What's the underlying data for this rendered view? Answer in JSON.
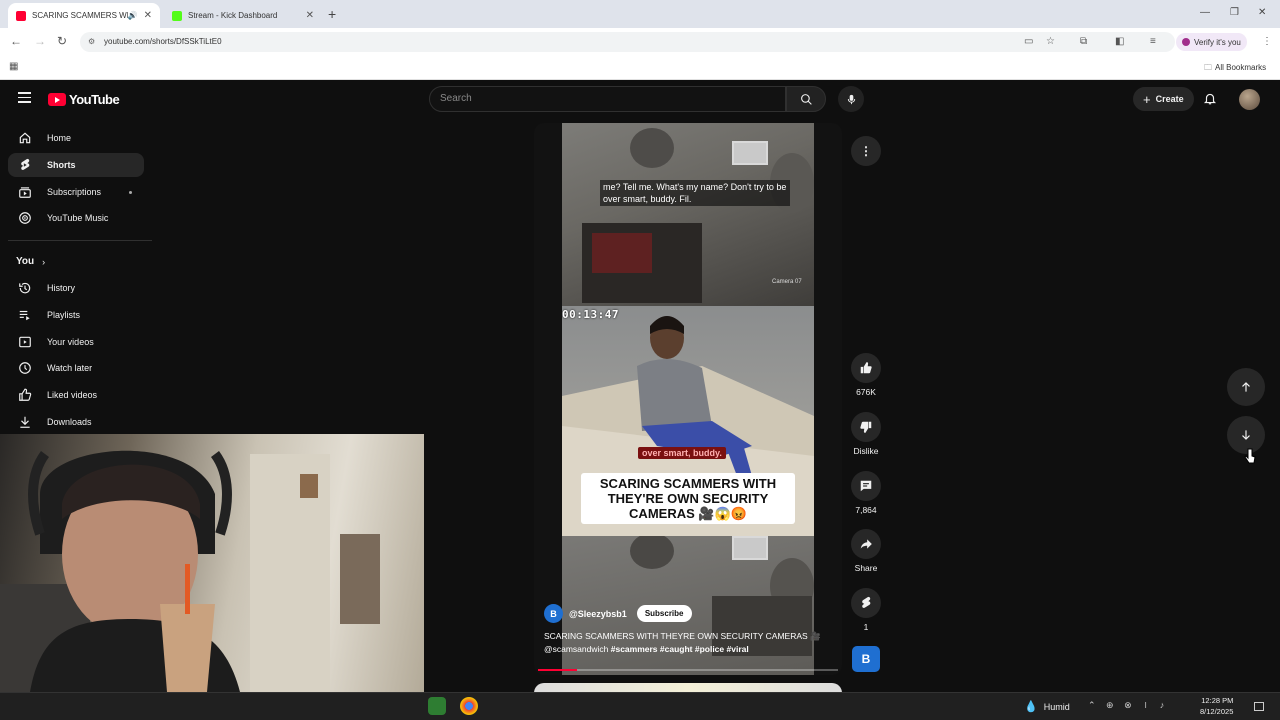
{
  "browser": {
    "tabs": [
      {
        "title": "SCARING SCAMMERS WITH",
        "active": true
      },
      {
        "title": "Stream - Kick Dashboard",
        "active": false
      }
    ],
    "url": "youtube.com/shorts/DfSSkTiLtE0",
    "verify_label": "Verify it's you",
    "all_bookmarks_label": "All Bookmarks"
  },
  "youtube": {
    "logo_text": "YouTube",
    "search_placeholder": "Search",
    "create_label": "Create",
    "sidebar": {
      "main": [
        {
          "label": "Home",
          "icon": "home-icon"
        },
        {
          "label": "Shorts",
          "icon": "shorts-icon"
        },
        {
          "label": "Subscriptions",
          "icon": "subscriptions-icon"
        },
        {
          "label": "YouTube Music",
          "icon": "youtube-music-icon"
        }
      ],
      "you_label": "You",
      "you_items": [
        {
          "label": "History",
          "icon": "history-icon"
        },
        {
          "label": "Playlists",
          "icon": "playlists-icon"
        },
        {
          "label": "Your videos",
          "icon": "your-videos-icon"
        },
        {
          "label": "Watch later",
          "icon": "watch-later-icon"
        },
        {
          "label": "Liked videos",
          "icon": "liked-videos-icon"
        },
        {
          "label": "Downloads",
          "icon": "downloads-icon"
        }
      ]
    },
    "short": {
      "caption": "me? Tell me. What's my name? Don't try to be over smart, buddy. Fil.",
      "timecode": "00:13:47",
      "camera_label": "Camera 07",
      "overlay_text": "over smart, buddy.",
      "headline": "SCARING SCAMMERS WITH THEY'RE OWN SECURITY CAMERAS 🎥😱😡",
      "channel_initial": "B",
      "channel_handle": "@Sleezybsb1",
      "subscribe_label": "Subscribe",
      "description_plain": "SCARING SCAMMERS WITH THEYRE OWN SECURITY CAMERAS 🎥",
      "description_mention": "@scamsandwich",
      "hashtags": "#scammers #caught #police #viral",
      "progress": 0.13
    },
    "actions": {
      "likes": "676K",
      "dislike_label": "Dislike",
      "comments": "7,864",
      "share_label": "Share",
      "remix_count": "1",
      "channel_initial": "B"
    }
  },
  "taskbar": {
    "weather": "Humid",
    "time": "12:28 PM",
    "date": "8/12/2025"
  },
  "colors": {
    "yt_red": "#ff0033",
    "bg": "#0f0f0f",
    "surface": "#272727"
  }
}
